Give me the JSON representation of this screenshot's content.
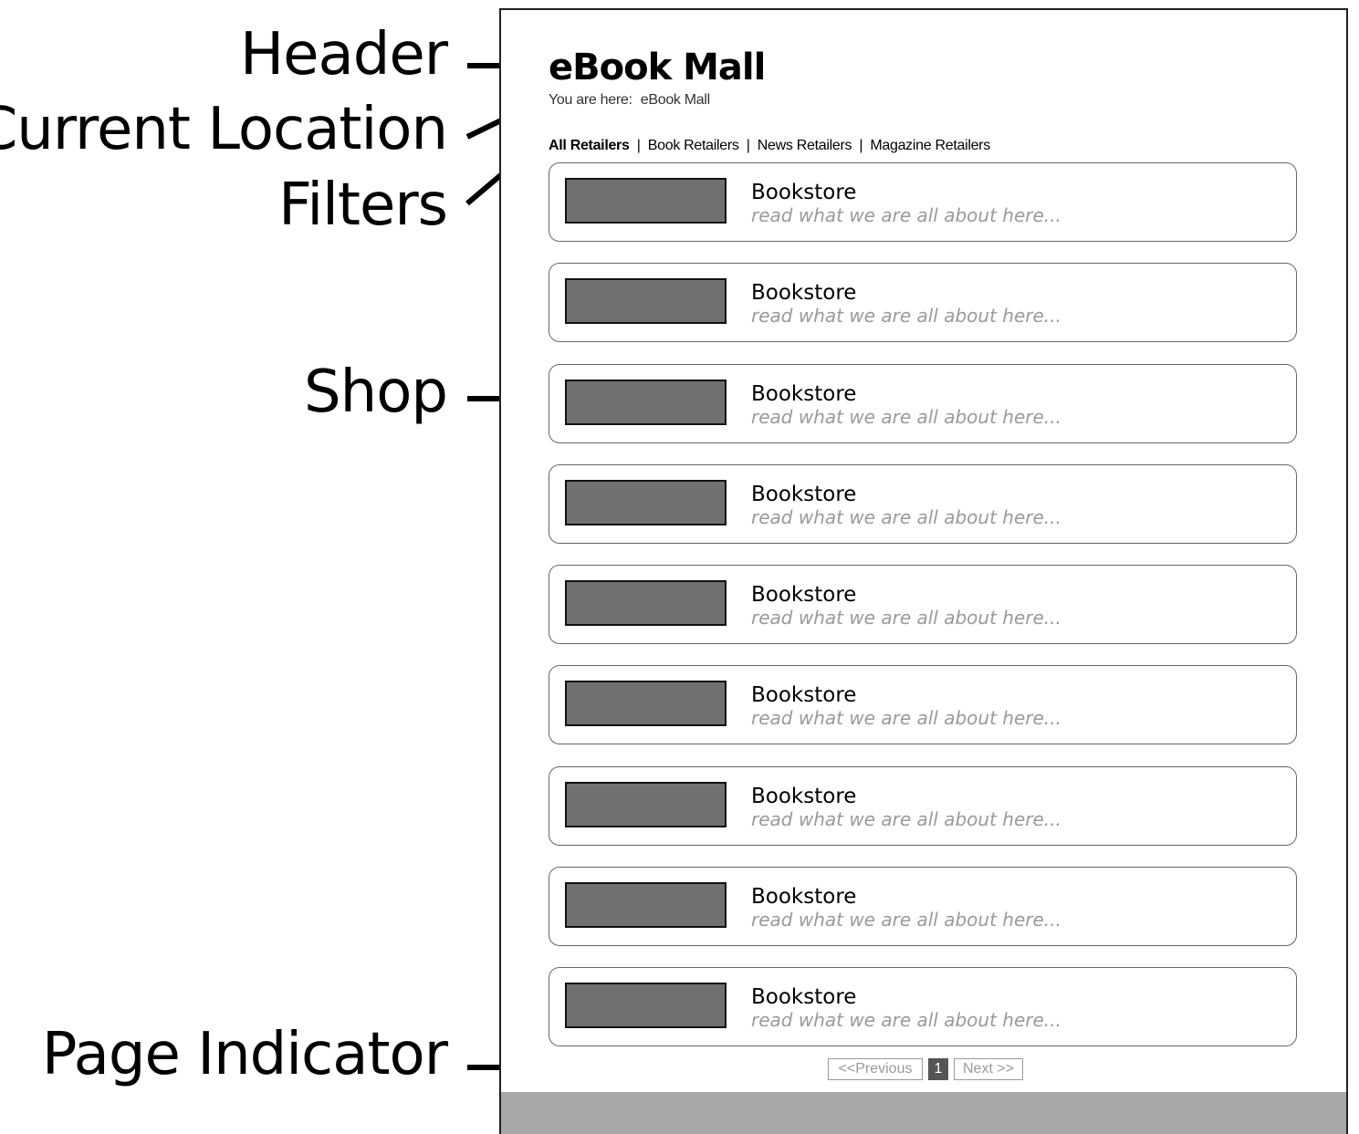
{
  "callouts": {
    "header": "Header",
    "current_location": "Current Location",
    "filters": "Filters",
    "shop": "Shop",
    "page_indicator": "Page Indicator"
  },
  "app": {
    "title": "eBook Mall",
    "breadcrumb_prefix": "You are here:",
    "breadcrumb_current": "eBook Mall"
  },
  "filters": [
    {
      "label": "All Retailers",
      "active": true
    },
    {
      "label": "Book Retailers",
      "active": false
    },
    {
      "label": "News Retailers",
      "active": false
    },
    {
      "label": "Magazine Retailers",
      "active": false
    }
  ],
  "filter_separator": "|",
  "shops": [
    {
      "name": "Bookstore",
      "tagline": "read what we are all about here..."
    },
    {
      "name": "Bookstore",
      "tagline": "read what we are all about here..."
    },
    {
      "name": "Bookstore",
      "tagline": "read what we are all about here..."
    },
    {
      "name": "Bookstore",
      "tagline": "read what we are all about here..."
    },
    {
      "name": "Bookstore",
      "tagline": "read what we are all about here..."
    },
    {
      "name": "Bookstore",
      "tagline": "read what we are all about here..."
    },
    {
      "name": "Bookstore",
      "tagline": "read what we are all about here..."
    },
    {
      "name": "Bookstore",
      "tagline": "read what we are all about here..."
    },
    {
      "name": "Bookstore",
      "tagline": "read what we are all about here..."
    }
  ],
  "pagination": {
    "previous": "<<Previous",
    "current_page": "1",
    "next": "Next >>"
  },
  "colors": {
    "thumbnail": "#707070",
    "footer_bar": "#a8a8a8",
    "muted_text": "#9a9a9a"
  }
}
